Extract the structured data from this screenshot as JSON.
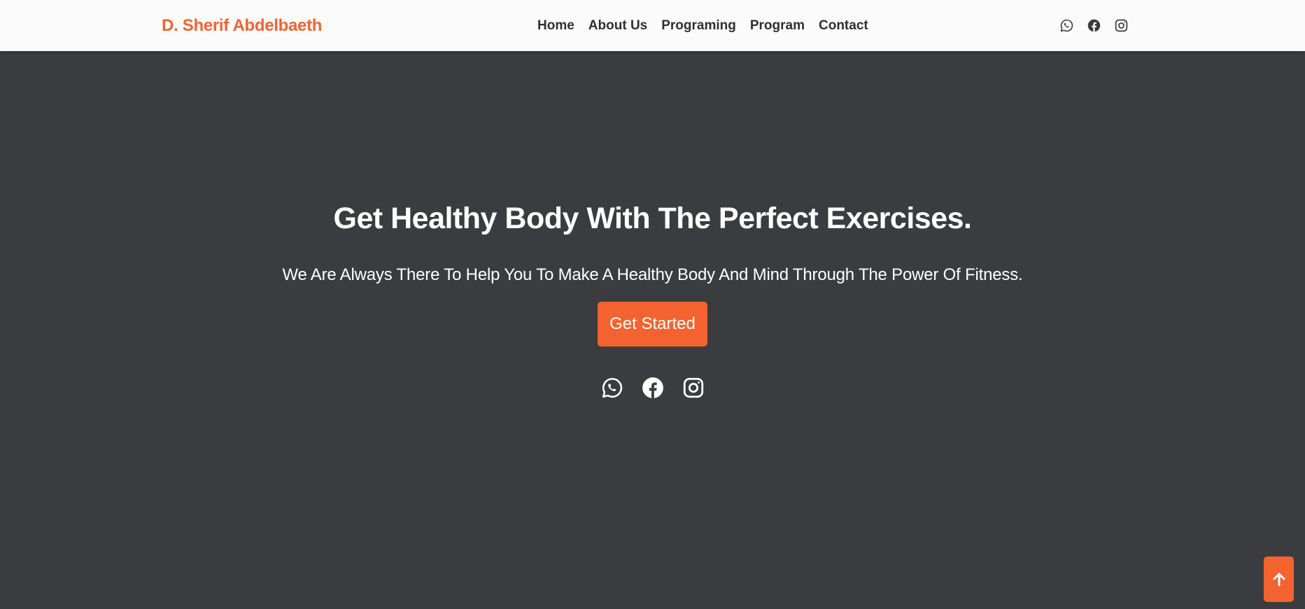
{
  "header": {
    "brand": "D. Sherif Abdelbaeth",
    "nav": [
      "Home",
      "About Us",
      "Programing",
      "Program",
      "Contact"
    ],
    "social_icons": [
      "whatsapp-icon",
      "facebook-icon",
      "instagram-icon"
    ]
  },
  "hero": {
    "title": "Get Healthy Body With The Perfect Exercises.",
    "subtitle": "We Are Always There To Help You To Make A Healthy Body And Mind Through The Power Of Fitness.",
    "cta_label": "Get Started",
    "social_icons": [
      "whatsapp-icon",
      "facebook-icon",
      "instagram-icon"
    ]
  },
  "scroll_top_icon": "arrow-up-icon",
  "colors": {
    "accent": "#f4622f",
    "background": "#3b3c40",
    "navbar": "#fbfbfb",
    "nav_text": "#2f3033"
  }
}
